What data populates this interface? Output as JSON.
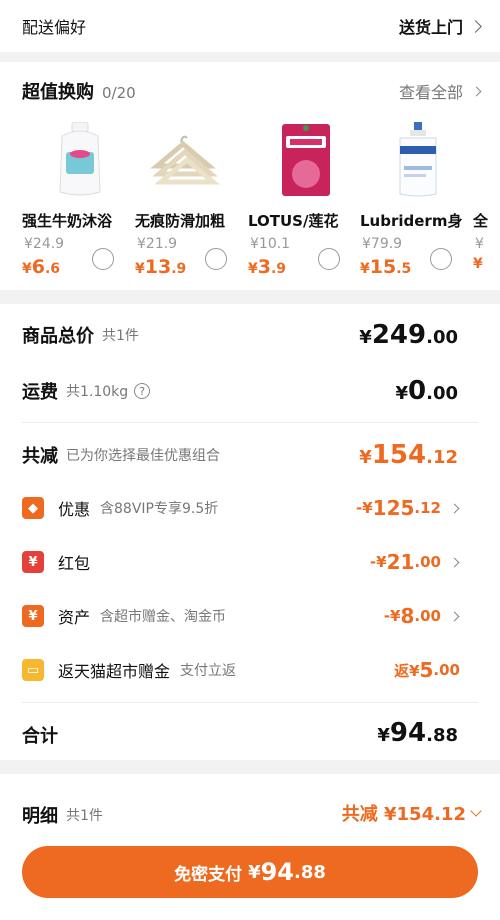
{
  "delivery": {
    "label": "配送偏好",
    "value": "送货上门"
  },
  "swap": {
    "title": "超值换购",
    "count": "0/20",
    "view_all": "查看全部",
    "products": [
      {
        "name": "强生牛奶沐浴",
        "orig": "¥24.9",
        "cur": "¥",
        "int": "6",
        "dec": ".6"
      },
      {
        "name": "无痕防滑加粗",
        "orig": "¥21.9",
        "cur": "¥",
        "int": "13",
        "dec": ".9"
      },
      {
        "name": "LOTUS/莲花",
        "orig": "¥10.1",
        "cur": "¥",
        "int": "3",
        "dec": ".9"
      },
      {
        "name": "Lubriderm身",
        "orig": "¥79.9",
        "cur": "¥",
        "int": "15",
        "dec": ".5"
      },
      {
        "name": "全",
        "orig": "¥",
        "cur": "¥",
        "int": "",
        "dec": ""
      }
    ]
  },
  "summary": {
    "goods": {
      "label": "商品总价",
      "sub": "共1件",
      "cur": "¥",
      "int": "249",
      "dec": ".00"
    },
    "shipping": {
      "label": "运费",
      "sub": "共1.10kg",
      "help_icon": "?",
      "cur": "¥",
      "int": "0",
      "dec": ".00"
    },
    "reduce": {
      "label": "共减",
      "sub": "已为你选择最佳优惠组合",
      "cur": "¥",
      "int": "154",
      "dec": ".12"
    },
    "discounts": [
      {
        "icon": "coupon-icon",
        "glyph": "◆",
        "color": "#ee6a20",
        "label": "优惠",
        "sub": "含88VIP专享9.5折",
        "prefix": "-¥",
        "int": "125",
        "dec": ".12"
      },
      {
        "icon": "red-packet-icon",
        "glyph": "¥",
        "color": "#e5413a",
        "label": "红包",
        "sub": "",
        "prefix": "-¥",
        "int": "21",
        "dec": ".00"
      },
      {
        "icon": "assets-icon",
        "glyph": "¥",
        "color": "#ee6a20",
        "label": "资产",
        "sub": "含超市赠金、淘金币",
        "prefix": "-¥",
        "int": "8",
        "dec": ".00"
      },
      {
        "icon": "gift-icon",
        "glyph": "▭",
        "color": "#f5b830",
        "label": "返天猫超市赠金",
        "sub": "支付立返",
        "prefix": "返¥",
        "int": "5",
        "dec": ".00"
      }
    ],
    "total": {
      "label": "合计",
      "cur": "¥",
      "int": "94",
      "dec": ".88"
    }
  },
  "detail": {
    "label": "明细",
    "sub": "共1件",
    "reduce_text": "共减 ¥154.12",
    "pay_label": "免密支付",
    "pay_cur": "¥",
    "pay_int": "94",
    "pay_dec": ".88"
  }
}
